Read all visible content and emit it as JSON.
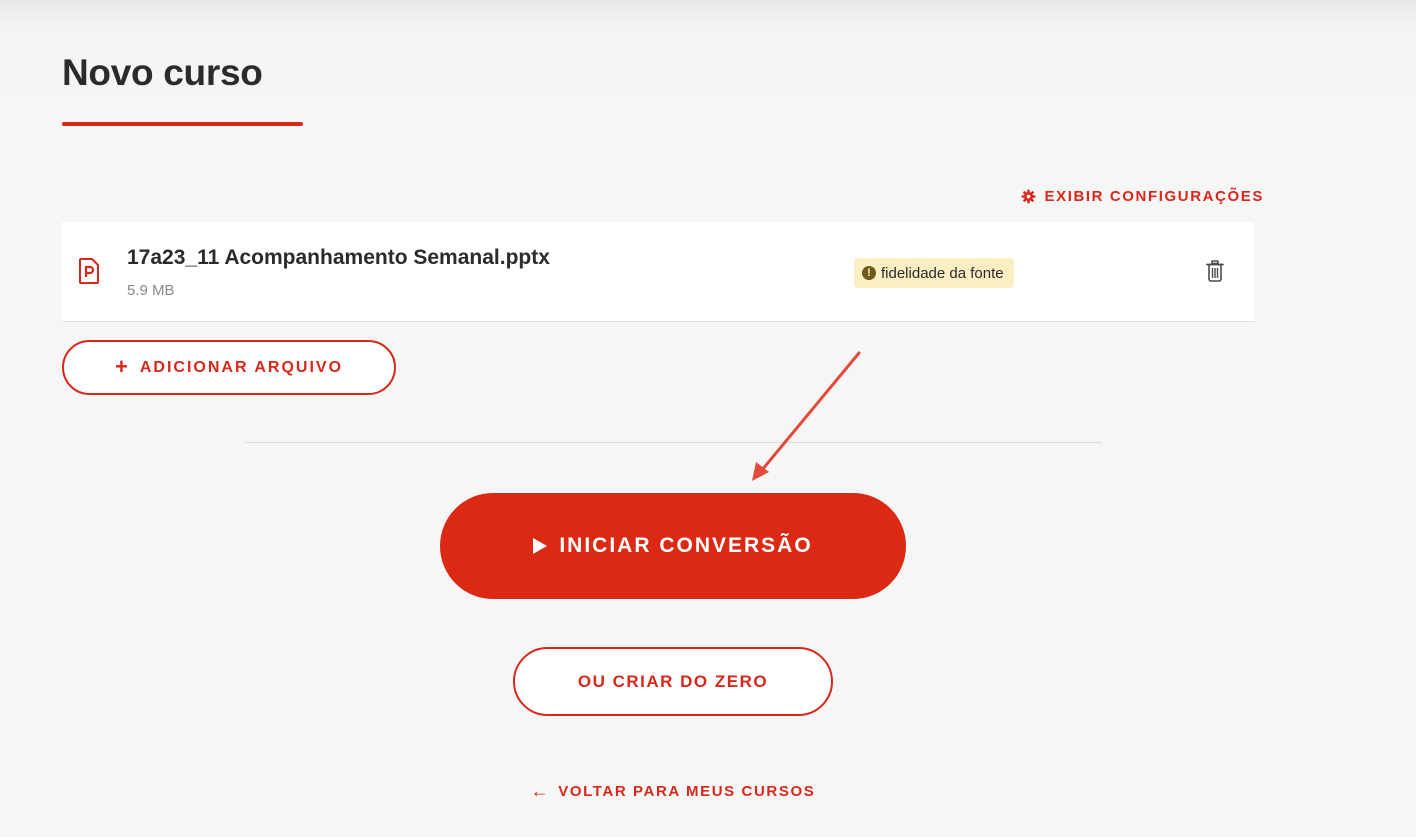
{
  "page": {
    "title": "Novo curso"
  },
  "settings_link": {
    "label": "EXIBIR CONFIGURAÇÕES",
    "icon": "gear-icon"
  },
  "files": [
    {
      "name": "17a23_11 Acompanhamento Semanal.pptx",
      "size": "5.9 MB",
      "icon": "powerpoint-file-icon",
      "badge": {
        "label": "fidelidade da fonte",
        "icon": "alert-icon",
        "glyph": "!"
      },
      "delete_icon": "trash-icon"
    }
  ],
  "actions": {
    "add_file": {
      "label": "ADICIONAR ARQUIVO",
      "glyph": "+"
    },
    "start_conversion": {
      "label": "INICIAR CONVERSÃO"
    },
    "create_from_scratch": {
      "label": "OU CRIAR DO ZERO"
    },
    "back": {
      "label": "VOLTAR PARA MEUS CURSOS",
      "glyph": "←"
    }
  },
  "colors": {
    "accent": "#d9271a",
    "primary_button": "#dc2914",
    "badge_background": "#fbeec2",
    "annotation_arrow": "#e24a3a"
  }
}
